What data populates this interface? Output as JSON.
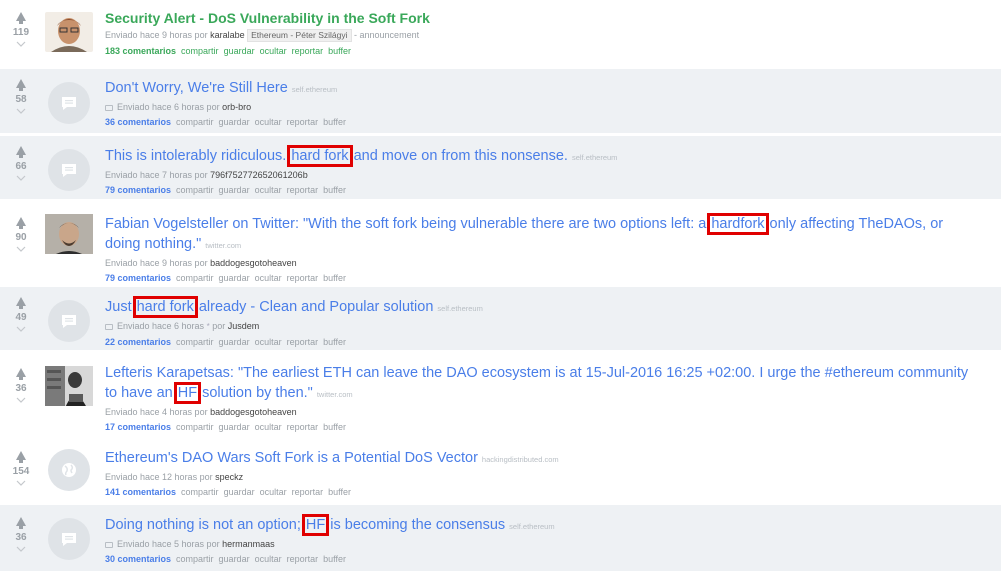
{
  "posts": [
    {
      "score": "119",
      "title": "Security Alert - DoS Vulnerability in the Soft Fork",
      "meta_prefix": "Enviado hace 9 horas por",
      "author": "karalabe",
      "flair": "Ethereum - Péter Szilágyi",
      "meta_suffix": "- announcement",
      "comments": "183 comentarios"
    },
    {
      "score": "58",
      "title": "Don't Worry, We're Still Here",
      "domain": "self.ethereum",
      "meta_prefix": "Enviado hace 6 horas por",
      "author": "orb-bro",
      "comments": "36 comentarios"
    },
    {
      "score": "66",
      "title_a": "This is intolerably ridiculous.",
      "highlight": "hard fork",
      "title_b": "and move on from this nonsense.",
      "domain": "self.ethereum",
      "meta_prefix": "Enviado hace 7 horas por",
      "author": "796f752772652061206b",
      "comments": "79 comentarios"
    },
    {
      "score": "90",
      "title_a": "Fabian Vogelsteller on Twitter: \"With the soft fork being vulnerable there are two options left: a",
      "highlight": "hardfork",
      "title_b": "only affecting TheDAOs, or doing nothing.\"",
      "domain": "twitter.com",
      "meta_prefix": "Enviado hace 9 horas por",
      "author": "baddogesgotoheaven",
      "comments": "79 comentarios"
    },
    {
      "score": "49",
      "title_a": "Just",
      "highlight": "hard fork",
      "title_b": "already - Clean and Popular solution",
      "domain": "self.ethereum",
      "meta_prefix": "Enviado hace 6 horas",
      "star": "*",
      "meta_by": "por",
      "author": "Jusdem",
      "comments": "22 comentarios"
    },
    {
      "score": "36",
      "title_a": "Lefteris Karapetsas: \"The earliest ETH can leave the DAO ecosystem is at 15-Jul-2016 16:25 +02:00. I urge the #ethereum community to have an",
      "highlight": "HF",
      "title_b": "solution by then.\"",
      "domain": "twitter.com",
      "meta_prefix": "Enviado hace 4 horas por",
      "author": "baddogesgotoheaven",
      "comments": "17 comentarios"
    },
    {
      "score": "154",
      "title": "Ethereum's DAO Wars Soft Fork is a Potential DoS Vector",
      "domain": "hackingdistributed.com",
      "meta_prefix": "Enviado hace 12 horas por",
      "author": "speckz",
      "comments": "141 comentarios"
    },
    {
      "score": "36",
      "title_a": "Doing nothing is not an option;",
      "highlight": "HF",
      "title_b": "is becoming the consensus",
      "domain": "self.ethereum",
      "meta_prefix": "Enviado hace 5 horas por",
      "author": "hermanmaas",
      "comments": "30 comentarios"
    }
  ],
  "actions": {
    "share": "compartir",
    "save": "guardar",
    "hide": "ocultar",
    "report": "reportar",
    "buffer": "buffer"
  },
  "colors": {
    "link": "#4a7ee8",
    "featured": "#3aa85a",
    "highlight_box": "#e00000",
    "alt_row": "#eef1f4"
  }
}
